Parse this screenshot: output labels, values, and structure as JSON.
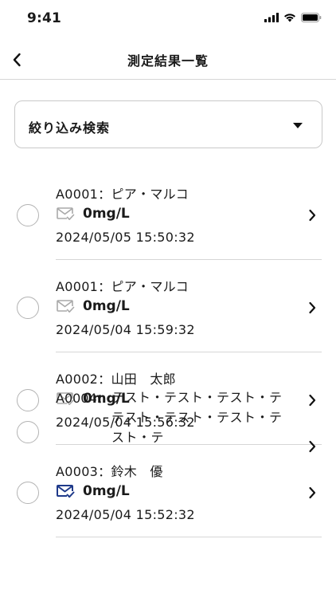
{
  "status_bar": {
    "time": "9:41"
  },
  "nav": {
    "title": "測定結果一覧",
    "back_icon": "chevron-left-icon"
  },
  "filter": {
    "label": "絞り込み検索",
    "icon": "caret-down-icon"
  },
  "items": [
    {
      "name": "A0001：ピア・マルコ",
      "value": "0mg/L",
      "date": "2024/05/05 15:50:32",
      "mail_status": "sent-gray"
    },
    {
      "name": "A0001：ピア・マルコ",
      "value": "0mg/L",
      "date": "2024/05/04 15:59:32",
      "mail_status": "sent-gray"
    },
    {
      "name": "A0002：山田　太郎",
      "value": "0mg/L",
      "date": "2024/05/04 15:56:32",
      "mail_status": "sent-gray"
    },
    {
      "name": "A0003：鈴木　優",
      "value": "0mg/L",
      "date": "2024/05/04 15:52:32",
      "mail_status": "sent-blue"
    }
  ],
  "partial_item": {
    "prefix": "A0004：",
    "name": "テスト・テスト・テスト・テテスト・テスト・テスト・テスト・テ"
  },
  "colors": {
    "mail_gray": "#a9a9a9",
    "mail_blue": "#1f3a8a",
    "divider": "#d6d6d6",
    "text": "#1a1a1a"
  }
}
